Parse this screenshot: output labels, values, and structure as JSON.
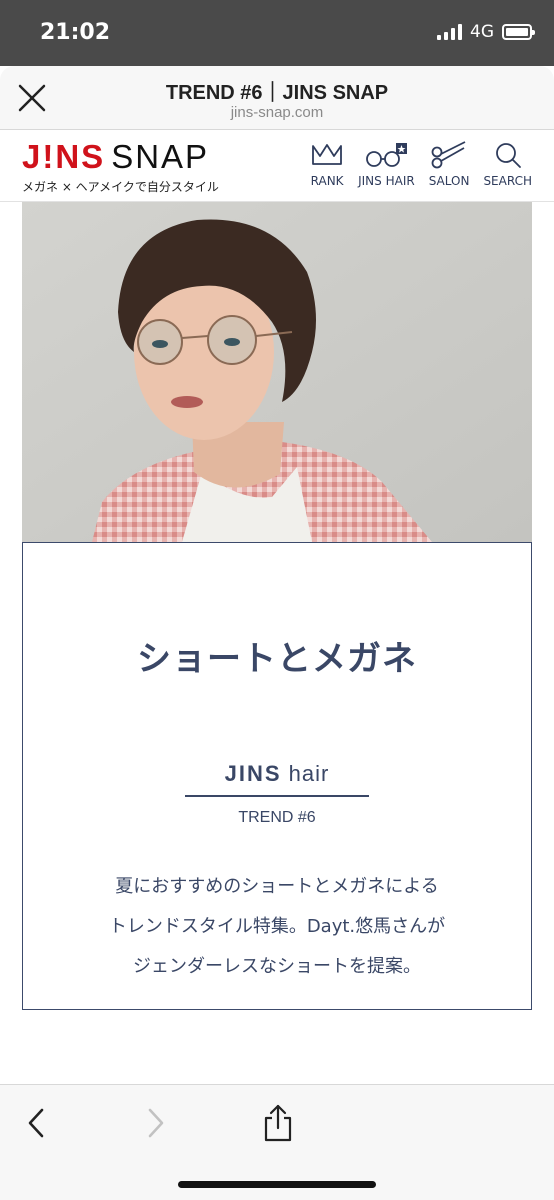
{
  "status_bar": {
    "time": "21:02",
    "network": "4G"
  },
  "browser": {
    "title": "TREND #6｜JINS SNAP",
    "url": "jins-snap.com"
  },
  "site": {
    "logo_jins": "J!NS",
    "logo_snap": "SNAP",
    "tagline": "メガネ × ヘアメイクで自分スタイル",
    "nav": [
      {
        "label": "RANK",
        "icon": "crown-icon"
      },
      {
        "label": "JINS HAIR",
        "icon": "glasses-star-icon"
      },
      {
        "label": "SALON",
        "icon": "scissors-icon"
      },
      {
        "label": "SEARCH",
        "icon": "search-icon"
      }
    ]
  },
  "article": {
    "title": "ショートとメガネ",
    "brand_bold": "JINS",
    "brand_light": "hair",
    "trend": "TREND #6",
    "desc_lines": [
      "夏におすすめのショートとメガネによる",
      "トレンドスタイル特集。Dayt.悠馬さんが",
      "ジェンダーレスなショートを提案。"
    ]
  },
  "colors": {
    "accent_navy": "#3a4766",
    "brand_red": "#d0121b"
  }
}
